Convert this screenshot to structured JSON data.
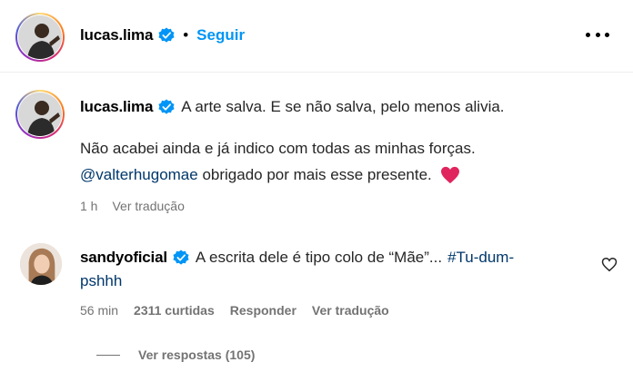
{
  "header": {
    "username": "lucas.lima",
    "separator": "•",
    "follow_label": "Seguir",
    "more_icon": "more-horizontal-icon"
  },
  "caption": {
    "username": "lucas.lima",
    "line1": "A arte salva. E se não salva, pelo menos alivia.",
    "line2": "Não acabei ainda e já indico com todas as minhas forças.",
    "mention": "@valterhugomae",
    "line3_rest": "obrigado por mais esse presente.",
    "emoji": "red-heart",
    "time": "1 h",
    "translate_label": "Ver tradução"
  },
  "comment": {
    "username": "sandyoficial",
    "text": "A escrita dele é tipo colo de “Mãe”...",
    "hashtag_part1": "#Tu-dum-",
    "hashtag_part2": "pshhh",
    "time": "56 min",
    "likes": "2311 curtidas",
    "reply_label": "Responder",
    "translate_label": "Ver tradução"
  },
  "replies": {
    "label": "Ver respostas (105)"
  },
  "colors": {
    "link_blue": "#0095f6",
    "mention_blue": "#00376b",
    "meta_gray": "#737373",
    "verified_blue": "#0095f6",
    "heart_red": "#e0245e"
  }
}
